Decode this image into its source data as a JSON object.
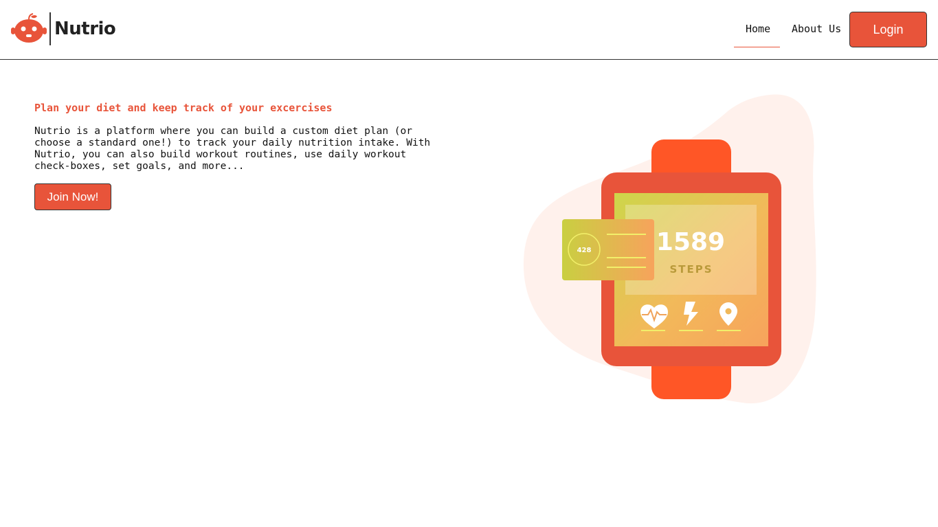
{
  "brand": {
    "name": "Nutrio"
  },
  "nav": {
    "home_label": "Home",
    "about_label": "About Us",
    "login_label": "Login"
  },
  "hero": {
    "title": "Plan your diet and keep track of your excercises",
    "description": "Nutrio is a platform where you can build a custom diet plan (or choose a standard one!) to track your daily nutrition intake. With Nutrio, you can also build workout routines, use daily workout check-boxes, set goals, and more...",
    "cta_label": "Join Now!"
  },
  "illustration": {
    "steps_value": "1589",
    "steps_label": "STEPS",
    "card_value": "428",
    "icons": [
      "heart-pulse-icon",
      "lightning-icon",
      "location-pin-icon"
    ]
  },
  "colors": {
    "accent": "#e8543a",
    "watch_band": "#ff5626",
    "blob": "#fff1ec"
  }
}
